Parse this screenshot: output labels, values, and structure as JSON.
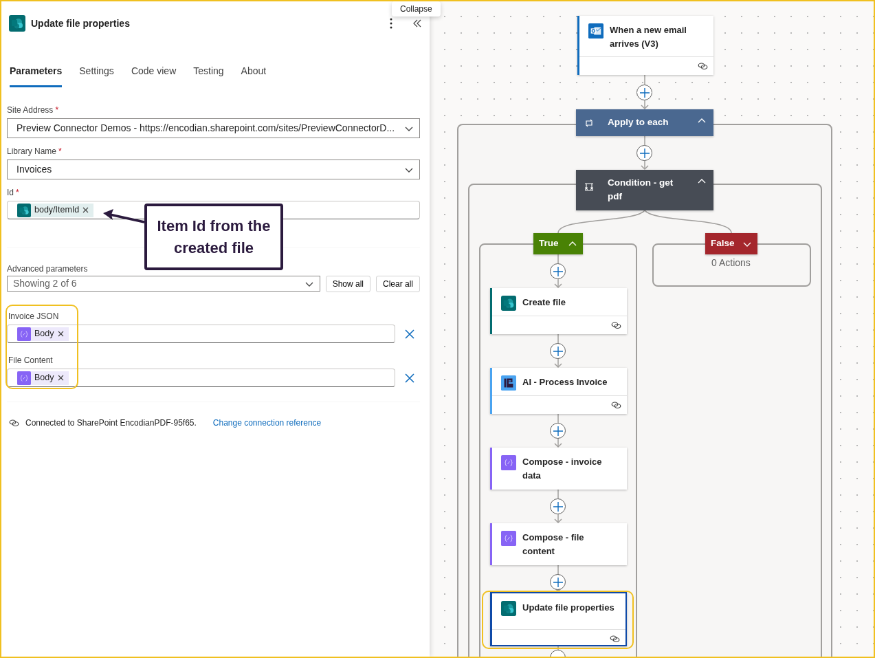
{
  "tooltip": {
    "text": "Collapse"
  },
  "panel": {
    "title": "Update file properties",
    "kind": "sharepoint",
    "tabs": [
      {
        "label": "Parameters",
        "selected": true
      },
      {
        "label": "Settings",
        "selected": false
      },
      {
        "label": "Code view",
        "selected": false
      },
      {
        "label": "Testing",
        "selected": false
      },
      {
        "label": "About",
        "selected": false
      }
    ],
    "fields": [
      {
        "kind": "select",
        "label": "Site Address",
        "required_mark": "*",
        "value": "Preview Connector Demos - https://encodian.sharepoint.com/sites/PreviewConnectorD..."
      },
      {
        "kind": "select",
        "label": "Library Name",
        "required_mark": "*",
        "value": "Invoices"
      },
      {
        "kind": "token",
        "label": "Id",
        "required_mark": "*",
        "token": {
          "kind": "sharepoint",
          "text": "body/ItemId"
        }
      }
    ],
    "advanced": {
      "label": "Advanced parameters",
      "value": "Showing 2 of 6",
      "buttons": [
        "Show all",
        "Clear all"
      ]
    },
    "dynamic_fields": [
      {
        "label": "Invoice JSON",
        "token": {
          "kind": "compose",
          "text": "Body"
        }
      },
      {
        "label": "File Content",
        "token": {
          "kind": "compose",
          "text": "Body"
        }
      }
    ],
    "connection": {
      "text": "Connected to SharePoint EncodianPDF-95f65.",
      "link": "Change connection reference"
    }
  },
  "annotation": {
    "text": "Item Id from the created file"
  },
  "flow": {
    "trigger": {
      "title": "When a new email arrives (V3)",
      "kind": "outlook"
    },
    "loop": {
      "title": "Apply to each",
      "expanded": true
    },
    "condition": {
      "title": "Condition - get pdf",
      "expanded": true
    },
    "branches": [
      {
        "kind": "true",
        "label": "True",
        "expanded": true
      },
      {
        "kind": "false",
        "label": "False",
        "expanded": false,
        "empty_text": "0 Actions"
      }
    ],
    "actions": [
      {
        "title": "Create file",
        "kind": "sharepoint",
        "selected": false
      },
      {
        "title": "AI - Process Invoice",
        "kind": "ai",
        "selected": false
      },
      {
        "title": "Compose - invoice data",
        "kind": "compose",
        "selected": false
      },
      {
        "title": "Compose - file content",
        "kind": "compose",
        "selected": false
      },
      {
        "title": "Update file properties",
        "kind": "sharepoint",
        "selected": true
      }
    ]
  }
}
